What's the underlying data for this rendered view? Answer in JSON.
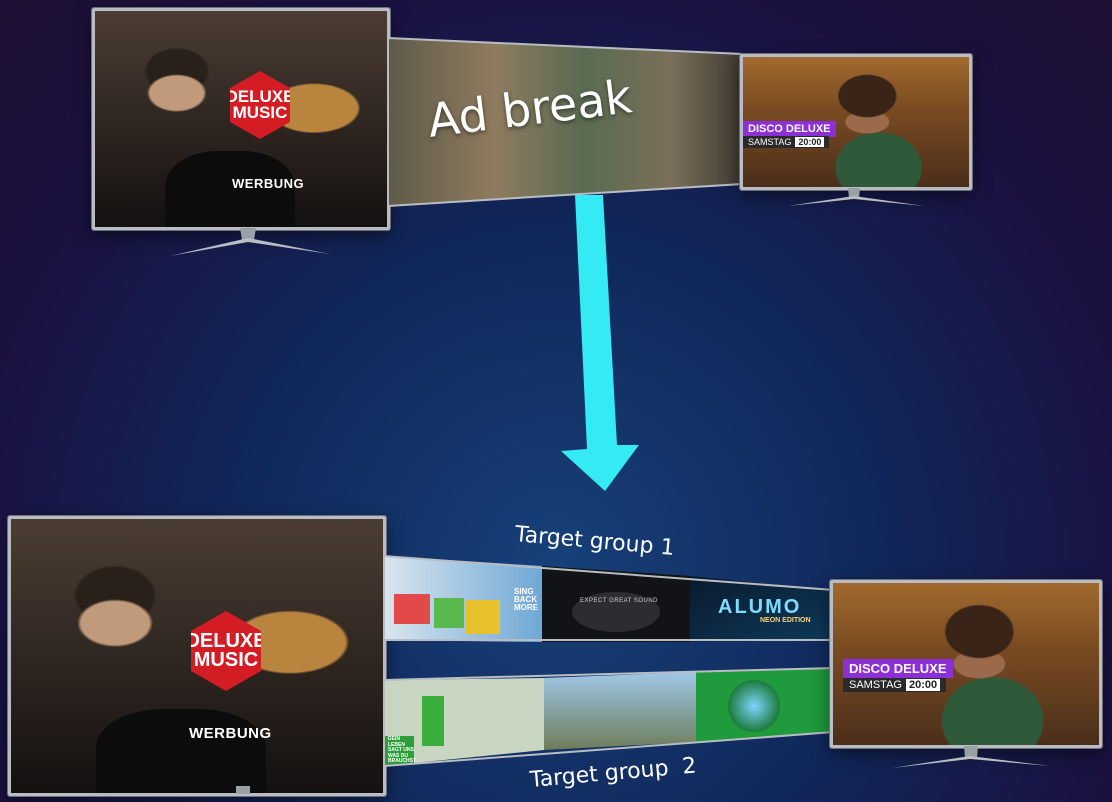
{
  "top": {
    "left_tv": {
      "logo_line1": "DELUXE",
      "logo_line2": "MUSIC",
      "overlay": "WERBUNG"
    },
    "center_label": "Ad break",
    "right_tv": {
      "show": "DISCO DELUXE",
      "day": "SAMSTAG",
      "time": "20:00"
    }
  },
  "bottom": {
    "left_tv": {
      "logo_line1": "DELUXE",
      "logo_line2": "MUSIC",
      "overlay": "WERBUNG"
    },
    "group1_label": "Target group 1",
    "group2_label": "Target group  2",
    "group1_ads": [
      {
        "name": "sing back more",
        "text": "SING BACK MORE"
      },
      {
        "name": "polk",
        "text": "EXPECT GREAT SOUND"
      },
      {
        "name": "alumo",
        "text": "ALUMO",
        "sub": "NEON EDITION"
      }
    ],
    "group2_ads": [
      {
        "name": "store",
        "text": "DEIN LEBEN SAGT UNS, WAS DU BRAUCHST."
      },
      {
        "name": "family",
        "text": ""
      },
      {
        "name": "globe",
        "text": ""
      }
    ],
    "right_tv": {
      "show": "DISCO DELUXE",
      "day": "SAMSTAG",
      "time": "20:00"
    }
  },
  "colors": {
    "arrow": "#33eaf5",
    "logo_red": "#d31c24",
    "disco_purple": "#8d2fd6"
  }
}
